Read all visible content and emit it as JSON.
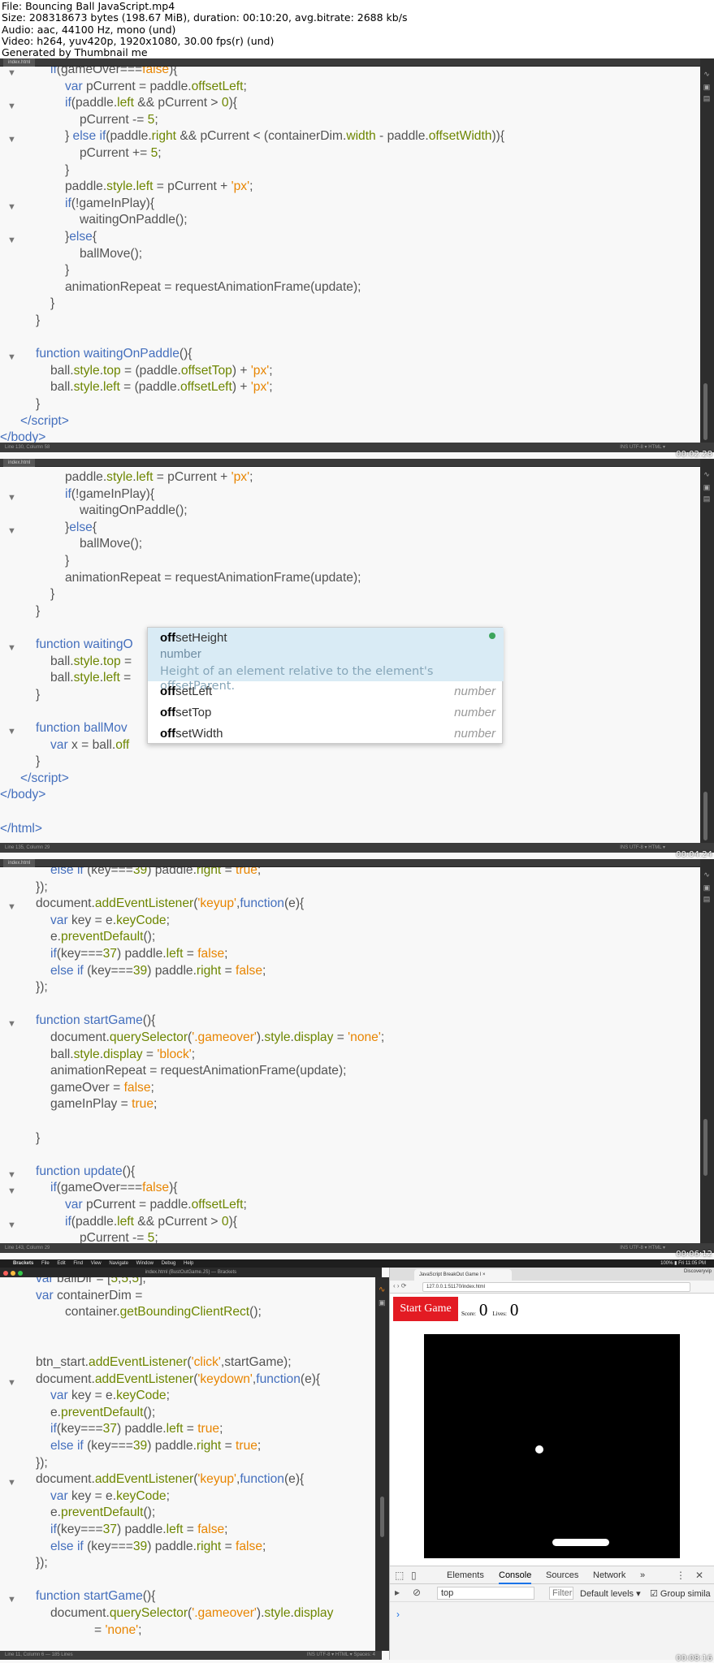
{
  "header": {
    "lines": [
      "File: Bouncing Ball JavaScript.mp4",
      "Size: 208318673 bytes (198.67 MiB), duration: 00:10:20, avg.bitrate: 2688 kb/s",
      "Audio: aac, 44100 Hz, mono (und)",
      "Video: h264, yuv420p, 1920x1080, 30.00 fps(r) (und)",
      "Generated by Thumbnail me"
    ]
  },
  "panels": [
    {
      "tab": "index.html",
      "status": "Line 130, Column 58",
      "status_right": "INS   UTF-8 ▾   HTML ▾",
      "timecode": "00:02:28",
      "lines": [
        {
          "indent": 3,
          "fold": true,
          "html": "<span class=\"kw\">if</span>(gameOver===<span class=\"lit\">false</span>){"
        },
        {
          "indent": 4,
          "fold": false,
          "html": "<span class=\"kw\">var</span> pCurrent = paddle.<span class=\"prop\">offsetLeft</span>;"
        },
        {
          "indent": 4,
          "fold": true,
          "html": "<span class=\"kw\">if</span>(paddle.<span class=\"prop\">left</span> &amp;&amp; pCurrent &gt; <span class=\"num\">0</span>){"
        },
        {
          "indent": 5,
          "fold": false,
          "html": "pCurrent -= <span class=\"num\">5</span>;"
        },
        {
          "indent": 4,
          "fold": true,
          "html": "} <span class=\"kw\">else if</span>(paddle.<span class=\"prop\">right</span> &amp;&amp; pCurrent &lt; (containerDim.<span class=\"prop\">width</span> - paddle.<span class=\"prop\">offsetWidth</span>)){"
        },
        {
          "indent": 5,
          "fold": false,
          "html": "pCurrent += <span class=\"num\">5</span>;"
        },
        {
          "indent": 4,
          "fold": false,
          "html": "}"
        },
        {
          "indent": 4,
          "fold": false,
          "html": "paddle.<span class=\"prop\">style</span>.<span class=\"prop\">left</span> = pCurrent + <span class=\"str\">'px'</span>;"
        },
        {
          "indent": 4,
          "fold": true,
          "html": "<span class=\"kw\">if</span>(!gameInPlay){"
        },
        {
          "indent": 5,
          "fold": false,
          "html": "waitingOnPaddle();"
        },
        {
          "indent": 4,
          "fold": true,
          "html": "}<span class=\"kw\">else</span>{"
        },
        {
          "indent": 5,
          "fold": false,
          "html": "ballMove();"
        },
        {
          "indent": 4,
          "fold": false,
          "html": "}"
        },
        {
          "indent": 4,
          "fold": false,
          "html": "animationRepeat = requestAnimationFrame(update);"
        },
        {
          "indent": 3,
          "fold": false,
          "html": "}"
        },
        {
          "indent": 2,
          "fold": false,
          "html": "}"
        },
        {
          "indent": 0,
          "fold": false,
          "html": ""
        },
        {
          "indent": 2,
          "fold": true,
          "html": "<span class=\"kw\">function</span> <span class=\"fn\">waitingOnPaddle</span>(){"
        },
        {
          "indent": 3,
          "fold": false,
          "html": "ball.<span class=\"prop\">style</span>.<span class=\"prop\">top</span> = (paddle.<span class=\"prop\">offsetTop</span>) + <span class=\"str\">'px'</span>;"
        },
        {
          "indent": 3,
          "fold": false,
          "html": "ball.<span class=\"prop\">style</span>.<span class=\"prop\">left</span> = (paddle.<span class=\"prop\">offsetLeft</span>) + <span class=\"str\">'px'</span>;"
        },
        {
          "indent": 2,
          "fold": false,
          "html": "}"
        },
        {
          "indent": 1,
          "fold": false,
          "html": "<span class=\"tag\">&lt;/script&gt;</span>"
        },
        {
          "indent": 0,
          "fold": false,
          "html": "<span class=\"tag\">&lt;/body&gt;</span>"
        }
      ]
    },
    {
      "tab": "index.html",
      "status": "Line 135, Column 29",
      "status_right": "INS   UTF-8 ▾   HTML ▾",
      "timecode": "00:04:24",
      "lines": [
        {
          "indent": 4,
          "fold": false,
          "html": "paddle.<span class=\"prop\">style</span>.<span class=\"prop\">left</span> = pCurrent + <span class=\"str\">'px'</span>;"
        },
        {
          "indent": 4,
          "fold": true,
          "html": "<span class=\"kw\">if</span>(!gameInPlay){"
        },
        {
          "indent": 5,
          "fold": false,
          "html": "waitingOnPaddle();"
        },
        {
          "indent": 4,
          "fold": true,
          "html": "}<span class=\"kw\">else</span>{"
        },
        {
          "indent": 5,
          "fold": false,
          "html": "ballMove();"
        },
        {
          "indent": 4,
          "fold": false,
          "html": "}"
        },
        {
          "indent": 4,
          "fold": false,
          "html": "animationRepeat = requestAnimationFrame(update);"
        },
        {
          "indent": 3,
          "fold": false,
          "html": "}"
        },
        {
          "indent": 2,
          "fold": false,
          "html": "}"
        },
        {
          "indent": 0,
          "fold": false,
          "html": ""
        },
        {
          "indent": 2,
          "fold": true,
          "html": "<span class=\"kw\">function</span> <span class=\"fn\">waitingO</span>"
        },
        {
          "indent": 3,
          "fold": false,
          "html": "ball.<span class=\"prop\">style</span>.<span class=\"prop\">top</span> ="
        },
        {
          "indent": 3,
          "fold": false,
          "html": "ball.<span class=\"prop\">style</span>.<span class=\"prop\">left</span> ="
        },
        {
          "indent": 2,
          "fold": false,
          "html": "}"
        },
        {
          "indent": 0,
          "fold": false,
          "html": ""
        },
        {
          "indent": 2,
          "fold": true,
          "html": "<span class=\"kw\">function</span> <span class=\"fn\">ballMov</span>"
        },
        {
          "indent": 3,
          "fold": false,
          "html": "<span class=\"kw\">var</span> x = ball.<span class=\"prop\">off</span>"
        },
        {
          "indent": 2,
          "fold": false,
          "html": "}"
        },
        {
          "indent": 1,
          "fold": false,
          "html": "<span class=\"tag\">&lt;/script&gt;</span>"
        },
        {
          "indent": 0,
          "fold": false,
          "html": "<span class=\"tag\">&lt;/body&gt;</span>"
        },
        {
          "indent": 0,
          "fold": false,
          "html": ""
        },
        {
          "indent": 0,
          "fold": false,
          "html": "<span class=\"tag\">&lt;/html&gt;</span>"
        }
      ]
    },
    {
      "tab": "index.html",
      "status": "Line 143, Column 29",
      "status_right": "INS   UTF-8 ▾   HTML ▾",
      "timecode": "00:06:12",
      "lines": [
        {
          "indent": 3,
          "fold": false,
          "html": "<span class=\"kw\">else if</span> (key===<span class=\"num\">39</span>) paddle.<span class=\"prop\">right</span> = <span class=\"lit\">true</span>;"
        },
        {
          "indent": 2,
          "fold": false,
          "html": "});"
        },
        {
          "indent": 2,
          "fold": true,
          "html": "document.<span class=\"prop\">addEventListener</span>(<span class=\"str\">'keyup'</span>,<span class=\"kw\">function</span>(e){"
        },
        {
          "indent": 3,
          "fold": false,
          "html": "<span class=\"kw\">var</span> key = e.<span class=\"prop\">keyCode</span>;"
        },
        {
          "indent": 3,
          "fold": false,
          "html": "e.<span class=\"prop\">preventDefault</span>();"
        },
        {
          "indent": 3,
          "fold": false,
          "html": "<span class=\"kw\">if</span>(key===<span class=\"num\">37</span>) paddle.<span class=\"prop\">left</span> = <span class=\"lit\">false</span>;"
        },
        {
          "indent": 3,
          "fold": false,
          "html": "<span class=\"kw\">else if</span> (key===<span class=\"num\">39</span>) paddle.<span class=\"prop\">right</span> = <span class=\"lit\">false</span>;"
        },
        {
          "indent": 2,
          "fold": false,
          "html": "});"
        },
        {
          "indent": 0,
          "fold": false,
          "html": ""
        },
        {
          "indent": 2,
          "fold": true,
          "html": "<span class=\"kw\">function</span> <span class=\"fn\">startGame</span>(){"
        },
        {
          "indent": 3,
          "fold": false,
          "html": "document.<span class=\"prop\">querySelector</span>(<span class=\"str\">'.gameover'</span>).<span class=\"prop\">style</span>.<span class=\"prop\">display</span> = <span class=\"str\">'none'</span>;"
        },
        {
          "indent": 3,
          "fold": false,
          "html": "ball.<span class=\"prop\">style</span>.<span class=\"prop\">display</span> = <span class=\"str\">'block'</span>;"
        },
        {
          "indent": 3,
          "fold": false,
          "html": "animationRepeat = requestAnimationFrame(update);"
        },
        {
          "indent": 3,
          "fold": false,
          "html": "gameOver = <span class=\"lit\">false</span>;"
        },
        {
          "indent": 3,
          "fold": false,
          "html": "gameInPlay = <span class=\"lit\">true</span>;"
        },
        {
          "indent": 0,
          "fold": false,
          "html": ""
        },
        {
          "indent": 2,
          "fold": false,
          "html": "}"
        },
        {
          "indent": 0,
          "fold": false,
          "html": ""
        },
        {
          "indent": 2,
          "fold": true,
          "html": "<span class=\"kw\">function</span> <span class=\"fn\">update</span>(){"
        },
        {
          "indent": 3,
          "fold": true,
          "html": "<span class=\"kw\">if</span>(gameOver===<span class=\"lit\">false</span>){"
        },
        {
          "indent": 4,
          "fold": false,
          "html": "<span class=\"kw\">var</span> pCurrent = paddle.<span class=\"prop\">offsetLeft</span>;"
        },
        {
          "indent": 4,
          "fold": true,
          "html": "<span class=\"kw\">if</span>(paddle.<span class=\"prop\">left</span> &amp;&amp; pCurrent &gt; <span class=\"num\">0</span>){"
        },
        {
          "indent": 5,
          "fold": false,
          "html": "pCurrent -= <span class=\"num\">5</span>;"
        }
      ]
    }
  ],
  "autocomplete": {
    "selected": {
      "bold": "off",
      "rest": "setHeight",
      "type": "number",
      "desc": "Height of an element relative to the element's offsetParent."
    },
    "items": [
      {
        "bold": "off",
        "rest": "setLeft",
        "type": "number"
      },
      {
        "bold": "off",
        "rest": "setTop",
        "type": "number"
      },
      {
        "bold": "off",
        "rest": "setWidth",
        "type": "number"
      }
    ]
  },
  "bottom": {
    "menubar": {
      "apple": "",
      "app": "Brackets",
      "items": [
        "File",
        "Edit",
        "Find",
        "View",
        "Navigate",
        "Window",
        "Debug",
        "Help"
      ],
      "right": "100% ▮  Fri 11:05 PM"
    },
    "window_title": "index.html (BustOutGame.JS) — Brackets",
    "status": "Line 11, Column 6 — 185 Lines",
    "status_right": "INS   UTF-8 ▾   HTML ▾   Spaces: 4",
    "timecode": "00:08:16",
    "lines": [
      {
        "indent": 2,
        "fold": false,
        "html": "<span class=\"kw\">var</span> ballDir = [<span class=\"num\">5</span>,<span class=\"num\">5</span>,<span class=\"num\">5</span>];"
      },
      {
        "indent": 2,
        "fold": false,
        "html": "<span class=\"kw\">var</span> containerDim ="
      },
      {
        "indent": 4,
        "fold": false,
        "html": "container.<span class=\"prop\">getBoundingClientRect</span>();"
      },
      {
        "indent": 0,
        "fold": false,
        "html": ""
      },
      {
        "indent": 0,
        "fold": false,
        "html": ""
      },
      {
        "indent": 2,
        "fold": false,
        "html": "btn_start.<span class=\"prop\">addEventListener</span>(<span class=\"str\">'click'</span>,startGame);"
      },
      {
        "indent": 2,
        "fold": true,
        "html": "document.<span class=\"prop\">addEventListener</span>(<span class=\"str\">'keydown'</span>,<span class=\"kw\">function</span>(e){"
      },
      {
        "indent": 3,
        "fold": false,
        "html": "<span class=\"kw\">var</span> key = e.<span class=\"prop\">keyCode</span>;"
      },
      {
        "indent": 3,
        "fold": false,
        "html": "e.<span class=\"prop\">preventDefault</span>();"
      },
      {
        "indent": 3,
        "fold": false,
        "html": "<span class=\"kw\">if</span>(key===<span class=\"num\">37</span>) paddle.<span class=\"prop\">left</span> = <span class=\"lit\">true</span>;"
      },
      {
        "indent": 3,
        "fold": false,
        "html": "<span class=\"kw\">else if</span> (key===<span class=\"num\">39</span>) paddle.<span class=\"prop\">right</span> = <span class=\"lit\">true</span>;"
      },
      {
        "indent": 2,
        "fold": false,
        "html": "});"
      },
      {
        "indent": 2,
        "fold": true,
        "html": "document.<span class=\"prop\">addEventListener</span>(<span class=\"str\">'keyup'</span>,<span class=\"kw\">function</span>(e){"
      },
      {
        "indent": 3,
        "fold": false,
        "html": "<span class=\"kw\">var</span> key = e.<span class=\"prop\">keyCode</span>;"
      },
      {
        "indent": 3,
        "fold": false,
        "html": "e.<span class=\"prop\">preventDefault</span>();"
      },
      {
        "indent": 3,
        "fold": false,
        "html": "<span class=\"kw\">if</span>(key===<span class=\"num\">37</span>) paddle.<span class=\"prop\">left</span> = <span class=\"lit\">false</span>;"
      },
      {
        "indent": 3,
        "fold": false,
        "html": "<span class=\"kw\">else if</span> (key===<span class=\"num\">39</span>) paddle.<span class=\"prop\">right</span> = <span class=\"lit\">false</span>;"
      },
      {
        "indent": 2,
        "fold": false,
        "html": "});"
      },
      {
        "indent": 0,
        "fold": false,
        "html": ""
      },
      {
        "indent": 2,
        "fold": true,
        "html": "<span class=\"kw\">function</span> <span class=\"fn\">startGame</span>(){"
      },
      {
        "indent": 3,
        "fold": false,
        "html": "document.<span class=\"prop\">querySelector</span>(<span class=\"str\">'.gameover'</span>).<span class=\"prop\">style</span>.<span class=\"prop\">display</span>"
      },
      {
        "indent": 6,
        "fold": false,
        "html": "= <span class=\"str\">'none'</span>;"
      }
    ],
    "browser": {
      "tab_title": "JavaScript BreakOut Game I ×",
      "profile": "Discoveryvip",
      "nav": "‹  ›  ⟳",
      "url": "127.0.0.1:51170/index.html",
      "start_button": "Start Game",
      "score_label": "Score:",
      "score": "0",
      "lives_label": "Lives:",
      "lives": "0",
      "devtools": {
        "tabs": [
          "Elements",
          "Console",
          "Sources",
          "Network"
        ],
        "active_tab": "Console",
        "more": "»",
        "context": "top",
        "filter_placeholder": "Filter",
        "levels": "Default levels ▾",
        "group_similar": "Group simila",
        "prompt": "›"
      }
    }
  }
}
